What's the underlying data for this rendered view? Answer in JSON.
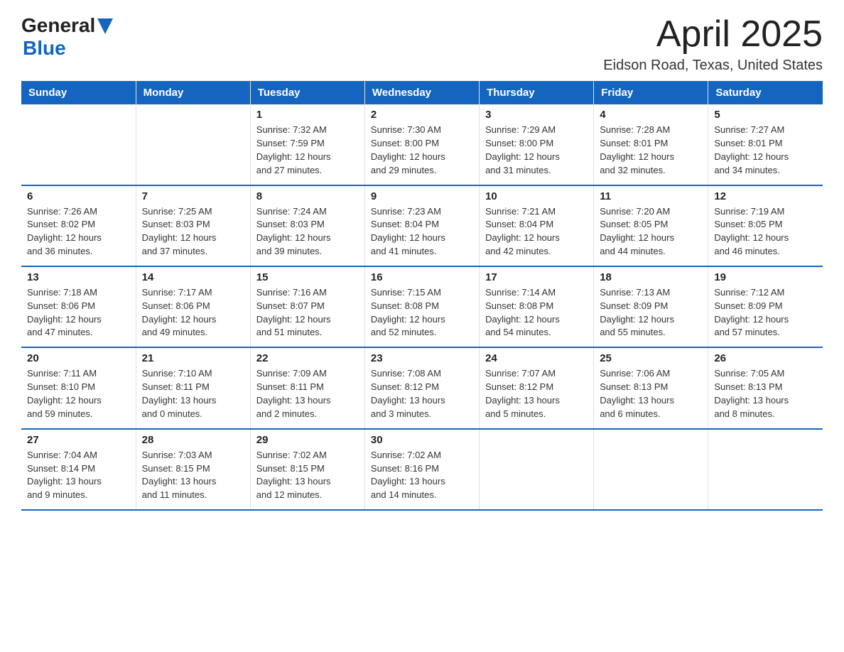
{
  "logo": {
    "general": "General",
    "blue": "Blue",
    "arrow": "▶"
  },
  "title": "April 2025",
  "subtitle": "Eidson Road, Texas, United States",
  "days_of_week": [
    "Sunday",
    "Monday",
    "Tuesday",
    "Wednesday",
    "Thursday",
    "Friday",
    "Saturday"
  ],
  "weeks": [
    [
      {
        "day": "",
        "info": ""
      },
      {
        "day": "",
        "info": ""
      },
      {
        "day": "1",
        "info": "Sunrise: 7:32 AM\nSunset: 7:59 PM\nDaylight: 12 hours\nand 27 minutes."
      },
      {
        "day": "2",
        "info": "Sunrise: 7:30 AM\nSunset: 8:00 PM\nDaylight: 12 hours\nand 29 minutes."
      },
      {
        "day": "3",
        "info": "Sunrise: 7:29 AM\nSunset: 8:00 PM\nDaylight: 12 hours\nand 31 minutes."
      },
      {
        "day": "4",
        "info": "Sunrise: 7:28 AM\nSunset: 8:01 PM\nDaylight: 12 hours\nand 32 minutes."
      },
      {
        "day": "5",
        "info": "Sunrise: 7:27 AM\nSunset: 8:01 PM\nDaylight: 12 hours\nand 34 minutes."
      }
    ],
    [
      {
        "day": "6",
        "info": "Sunrise: 7:26 AM\nSunset: 8:02 PM\nDaylight: 12 hours\nand 36 minutes."
      },
      {
        "day": "7",
        "info": "Sunrise: 7:25 AM\nSunset: 8:03 PM\nDaylight: 12 hours\nand 37 minutes."
      },
      {
        "day": "8",
        "info": "Sunrise: 7:24 AM\nSunset: 8:03 PM\nDaylight: 12 hours\nand 39 minutes."
      },
      {
        "day": "9",
        "info": "Sunrise: 7:23 AM\nSunset: 8:04 PM\nDaylight: 12 hours\nand 41 minutes."
      },
      {
        "day": "10",
        "info": "Sunrise: 7:21 AM\nSunset: 8:04 PM\nDaylight: 12 hours\nand 42 minutes."
      },
      {
        "day": "11",
        "info": "Sunrise: 7:20 AM\nSunset: 8:05 PM\nDaylight: 12 hours\nand 44 minutes."
      },
      {
        "day": "12",
        "info": "Sunrise: 7:19 AM\nSunset: 8:05 PM\nDaylight: 12 hours\nand 46 minutes."
      }
    ],
    [
      {
        "day": "13",
        "info": "Sunrise: 7:18 AM\nSunset: 8:06 PM\nDaylight: 12 hours\nand 47 minutes."
      },
      {
        "day": "14",
        "info": "Sunrise: 7:17 AM\nSunset: 8:06 PM\nDaylight: 12 hours\nand 49 minutes."
      },
      {
        "day": "15",
        "info": "Sunrise: 7:16 AM\nSunset: 8:07 PM\nDaylight: 12 hours\nand 51 minutes."
      },
      {
        "day": "16",
        "info": "Sunrise: 7:15 AM\nSunset: 8:08 PM\nDaylight: 12 hours\nand 52 minutes."
      },
      {
        "day": "17",
        "info": "Sunrise: 7:14 AM\nSunset: 8:08 PM\nDaylight: 12 hours\nand 54 minutes."
      },
      {
        "day": "18",
        "info": "Sunrise: 7:13 AM\nSunset: 8:09 PM\nDaylight: 12 hours\nand 55 minutes."
      },
      {
        "day": "19",
        "info": "Sunrise: 7:12 AM\nSunset: 8:09 PM\nDaylight: 12 hours\nand 57 minutes."
      }
    ],
    [
      {
        "day": "20",
        "info": "Sunrise: 7:11 AM\nSunset: 8:10 PM\nDaylight: 12 hours\nand 59 minutes."
      },
      {
        "day": "21",
        "info": "Sunrise: 7:10 AM\nSunset: 8:11 PM\nDaylight: 13 hours\nand 0 minutes."
      },
      {
        "day": "22",
        "info": "Sunrise: 7:09 AM\nSunset: 8:11 PM\nDaylight: 13 hours\nand 2 minutes."
      },
      {
        "day": "23",
        "info": "Sunrise: 7:08 AM\nSunset: 8:12 PM\nDaylight: 13 hours\nand 3 minutes."
      },
      {
        "day": "24",
        "info": "Sunrise: 7:07 AM\nSunset: 8:12 PM\nDaylight: 13 hours\nand 5 minutes."
      },
      {
        "day": "25",
        "info": "Sunrise: 7:06 AM\nSunset: 8:13 PM\nDaylight: 13 hours\nand 6 minutes."
      },
      {
        "day": "26",
        "info": "Sunrise: 7:05 AM\nSunset: 8:13 PM\nDaylight: 13 hours\nand 8 minutes."
      }
    ],
    [
      {
        "day": "27",
        "info": "Sunrise: 7:04 AM\nSunset: 8:14 PM\nDaylight: 13 hours\nand 9 minutes."
      },
      {
        "day": "28",
        "info": "Sunrise: 7:03 AM\nSunset: 8:15 PM\nDaylight: 13 hours\nand 11 minutes."
      },
      {
        "day": "29",
        "info": "Sunrise: 7:02 AM\nSunset: 8:15 PM\nDaylight: 13 hours\nand 12 minutes."
      },
      {
        "day": "30",
        "info": "Sunrise: 7:02 AM\nSunset: 8:16 PM\nDaylight: 13 hours\nand 14 minutes."
      },
      {
        "day": "",
        "info": ""
      },
      {
        "day": "",
        "info": ""
      },
      {
        "day": "",
        "info": ""
      }
    ]
  ]
}
